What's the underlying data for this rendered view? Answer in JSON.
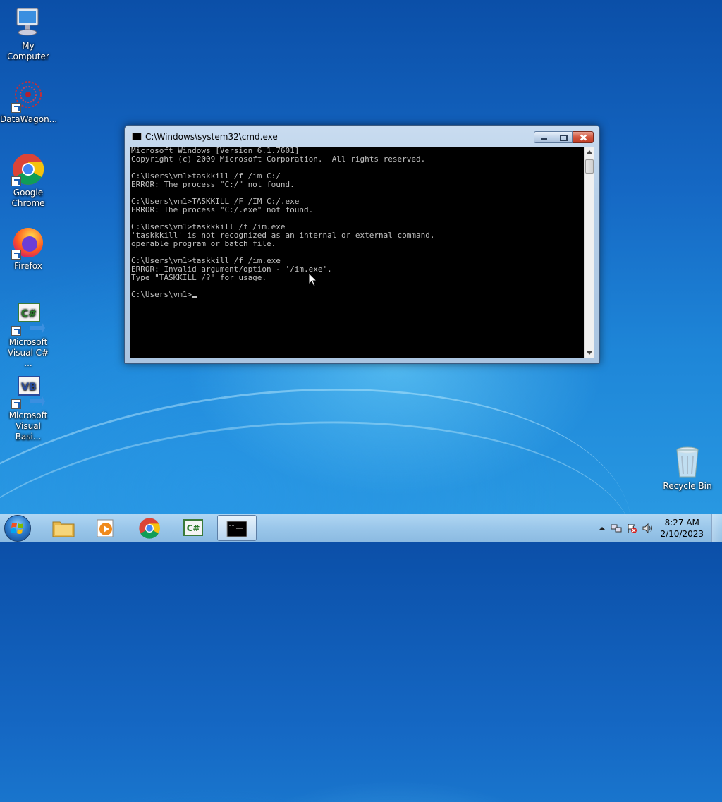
{
  "desktop": {
    "icons": [
      {
        "label": "My Computer"
      },
      {
        "label": "DataWagon..."
      },
      {
        "label": "Google Chrome"
      },
      {
        "label": "Firefox"
      },
      {
        "label": "Microsoft Visual C# ..."
      },
      {
        "label": "Microsoft Visual Basi..."
      },
      {
        "label": "Recycle Bin"
      }
    ]
  },
  "cmd_window": {
    "title": "C:\\Windows\\system32\\cmd.exe",
    "lines": [
      "Microsoft Windows [Version 6.1.7601]",
      "Copyright (c) 2009 Microsoft Corporation.  All rights reserved.",
      "",
      "C:\\Users\\vm1>taskkill /f /im C:/",
      "ERROR: The process \"C:/\" not found.",
      "",
      "C:\\Users\\vm1>TASKKILL /F /IM C:/.exe",
      "ERROR: The process \"C:/.exe\" not found.",
      "",
      "C:\\Users\\vm1>taskkkill /f /im.exe",
      "'taskkkill' is not recognized as an internal or external command,",
      "operable program or batch file.",
      "",
      "C:\\Users\\vm1>taskkill /f /im.exe",
      "ERROR: Invalid argument/option - '/im.exe'.",
      "Type \"TASKKILL /?\" for usage.",
      ""
    ],
    "prompt": "C:\\Users\\vm1>"
  },
  "taskbar": {
    "clock_time": "8:27 AM",
    "clock_date": "2/10/2023",
    "apps": [
      "windows-explorer",
      "media-player",
      "google-chrome",
      "visual-csharp",
      "command-prompt"
    ]
  },
  "colors": {
    "console_bg": "#000000",
    "console_fg": "#c0c0c0",
    "close_button": "#c8452d"
  }
}
